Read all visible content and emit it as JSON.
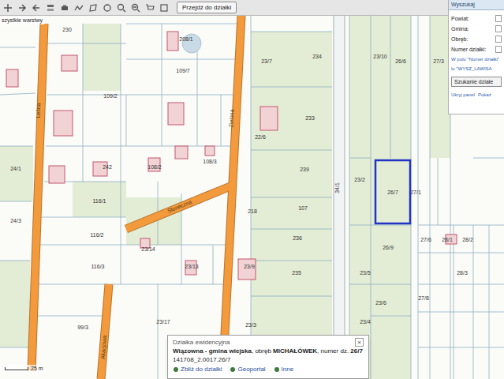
{
  "toolbar": {
    "button": "Przejdź do działki"
  },
  "layers_link": "szystkie warstwy",
  "streets": [
    "Leśna",
    "Zielona",
    "Słoneczna",
    "Akacjowa"
  ],
  "parcels": [
    {
      "number": "230",
      "selected": false
    },
    {
      "number": "208/1",
      "selected": false
    },
    {
      "number": "109/7",
      "selected": false
    },
    {
      "number": "109/2",
      "selected": false
    },
    {
      "number": "23/7",
      "selected": false
    },
    {
      "number": "234",
      "selected": false
    },
    {
      "number": "233",
      "selected": false
    },
    {
      "number": "23/10",
      "selected": false
    },
    {
      "number": "26/6",
      "selected": false
    },
    {
      "number": "27/3",
      "selected": false
    },
    {
      "number": "22/6",
      "selected": false
    },
    {
      "number": "242",
      "selected": false
    },
    {
      "number": "108/2",
      "selected": false
    },
    {
      "number": "108/3",
      "selected": false
    },
    {
      "number": "239",
      "selected": false
    },
    {
      "number": "23/2",
      "selected": false
    },
    {
      "number": "26/7",
      "selected": true
    },
    {
      "number": "27/1",
      "selected": false
    },
    {
      "number": "218",
      "selected": false
    },
    {
      "number": "107",
      "selected": false
    },
    {
      "number": "116/1",
      "selected": false
    },
    {
      "number": "116/2",
      "selected": false
    },
    {
      "number": "116/3",
      "selected": false
    },
    {
      "number": "23/14",
      "selected": false
    },
    {
      "number": "23/13",
      "selected": false
    },
    {
      "number": "23/9",
      "selected": false
    },
    {
      "number": "236",
      "selected": false
    },
    {
      "number": "235",
      "selected": false
    },
    {
      "number": "26/9",
      "selected": false
    },
    {
      "number": "23/5",
      "selected": false
    },
    {
      "number": "27/6",
      "selected": false
    },
    {
      "number": "28/1",
      "selected": false
    },
    {
      "number": "28/3",
      "selected": false
    },
    {
      "number": "99/3",
      "selected": false
    },
    {
      "number": "23/17",
      "selected": false
    },
    {
      "number": "23/3",
      "selected": false
    },
    {
      "number": "23/6",
      "selected": false
    },
    {
      "number": "23/4",
      "selected": false
    },
    {
      "number": "27/8",
      "selected": false
    },
    {
      "number": "28/2",
      "selected": false
    },
    {
      "number": "24/1",
      "selected": false
    },
    {
      "number": "24/3",
      "selected": false
    },
    {
      "number": "34/1",
      "selected": false
    }
  ],
  "search_panel": {
    "tab": "Wyszukaj",
    "fields": [
      "Powiat:",
      "Gmina:",
      "Obręb:",
      "Numer działki:"
    ],
    "hint": [
      "W polu \"Numer działki\"",
      "lu \"WYSZ_LAWISA"
    ],
    "button": "Szukanie działe",
    "links": [
      "Ukryj panel",
      "Pokaż"
    ]
  },
  "popup": {
    "title": "Działka ewidencyjna",
    "close": "×",
    "segments": [
      {
        "text": "Wiązowna - gmina wiejska",
        "bold": true
      },
      {
        "text": ", obręb ",
        "bold": false
      },
      {
        "text": "MICHAŁÓWEK",
        "bold": true
      },
      {
        "text": ", numer dz. ",
        "bold": false
      },
      {
        "text": "26/7",
        "bold": true
      }
    ],
    "id": "141708_2.0017.26/7",
    "links": [
      "Zbliż do działki",
      "Geoportal",
      "Inne"
    ]
  },
  "scale": "25 m"
}
